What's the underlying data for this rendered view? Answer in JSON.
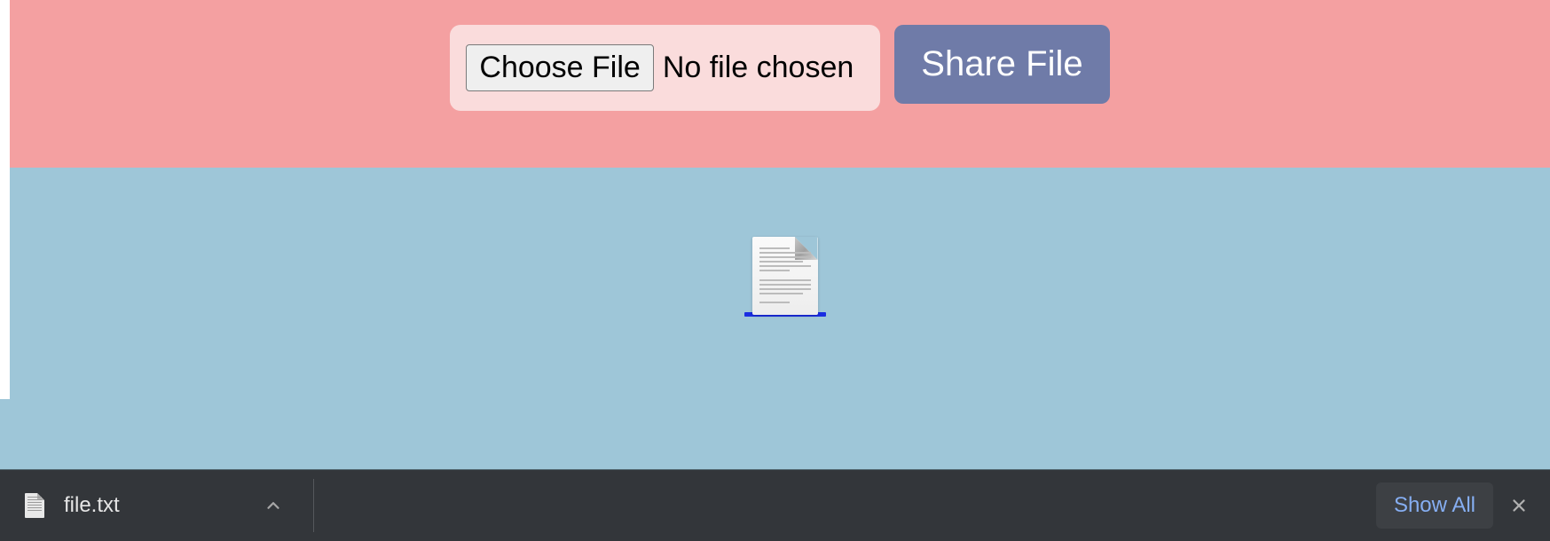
{
  "upload": {
    "choose_label": "Choose File",
    "status_text": "No file chosen",
    "share_label": "Share File"
  },
  "content": {
    "preview_icon": "document-icon"
  },
  "downloads_bar": {
    "item": {
      "filename": "file.txt",
      "icon": "text-file-icon"
    },
    "show_all_label": "Show All"
  },
  "colors": {
    "top_bg": "#f4a0a1",
    "content_bg": "#9ec6d8",
    "share_btn": "#6f7ba8",
    "bar_bg": "#33363a",
    "link_blue": "#86aef2",
    "select_blue": "#1a2de2"
  }
}
